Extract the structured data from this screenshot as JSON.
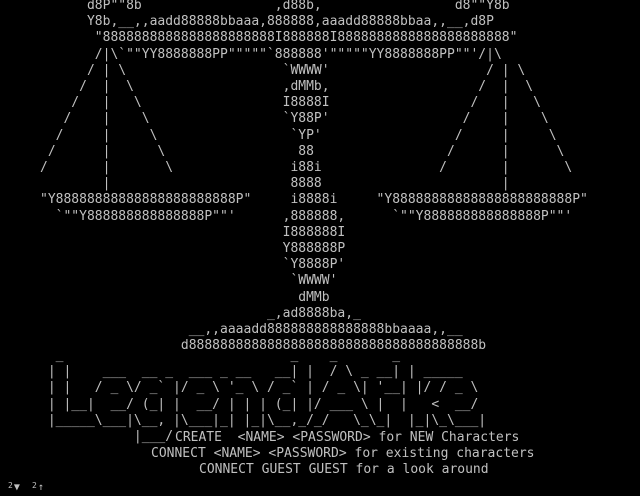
{
  "banner": {
    "scales_art": "      d8P\"\"8b                 ,d88b,                 d8\"\"Y8b\n      Y8b,__,,aadd88888bbaaa,888888,aaadd88888bbaa,,__,d8P\n       \"8888888888888888888888I888888I8888888888888888888888\"\n       /|\\`\"\"YY8888888PP\"\"\"\"\"`888888'\"\"\"\"\"YY8888888PP\"\"'/|\\\n      / | \\                    `WWWW'                    / | \\\n     /  |  \\                   ,dMMb,                   /  |  \\\n    /   |   \\                  I8888I                  /   |   \\\n   /    |    \\                 `Y88P'                 /    |    \\\n  /     |     \\                 `YP'                 /     |     \\\n /      |      \\                 88                 /      |      \\\n/       |       \\               i88i               /       |       \\\n        |                       8888                       |\n\"Y88888888888888888888888P\"     i8888i     \"Y88888888888888888888888P\"\n  `\"\"Y888888888888888P\"\"'      ,888888,      `\"\"Y888888888888888P\"\"'\n                               I888888I\n                               Y888888P\n                               `Y8888P'\n                                `WWWW'\n                                 dMMb\n                             _,ad8888ba,_\n                   __,,aaaadd888888888888888bbaaaa,,__\n                  d8888888888888888888888888888888888888b",
    "logo_art": "  _                             _    _       _\n | |    ___  __ _  ___ _ __   __| |  / \\ _ __| | _____\n | |   / _ \\/ _` |/ _ \\ '_ \\ / _` | / _ \\| '__| |/ / _ \\\n | |__|  __/ (_| |  __/ | | | (_| |/ ___ \\ |  |   <  __/\n |_____\\___|\\__, |\\___|_| |_|\\__,_/_/   \\_\\_|  |_|\\_\\___|\n            |___/"
  },
  "commands": [
    "CREATE  <NAME> <PASSWORD> for NEW Characters",
    "CONNECT <NAME> <PASSWORD> for existing characters",
    "CONNECT GUEST GUEST for a look around"
  ],
  "status": {
    "down_count": "2",
    "down_arrow": "▼",
    "up_count": "2",
    "up_arrow": "↑"
  },
  "colors": {
    "background": "#000000",
    "text": "#c0c0c0"
  }
}
